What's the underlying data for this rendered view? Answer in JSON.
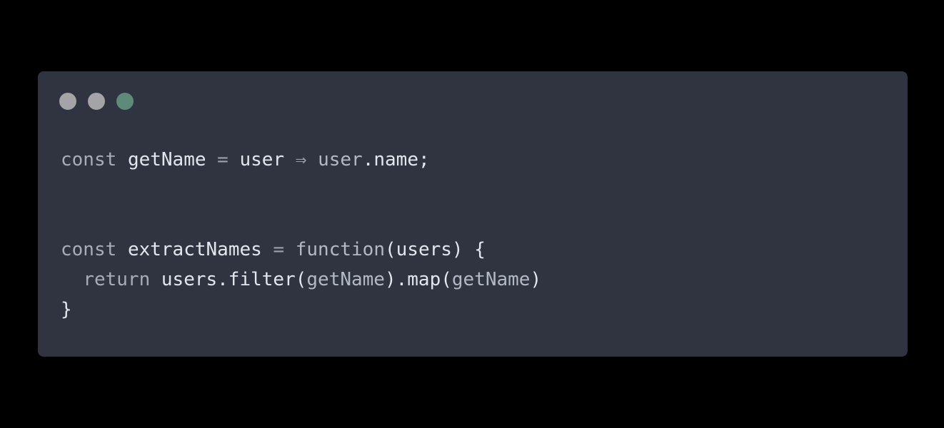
{
  "window": {
    "background": "#303441",
    "dots": [
      {
        "name": "close-dot",
        "color": "#a4a4a6"
      },
      {
        "name": "minimize-dot",
        "color": "#a4a4a6"
      },
      {
        "name": "maximize-dot",
        "color": "#5e8a7c"
      }
    ]
  },
  "code": {
    "lines": [
      [
        {
          "text": "const",
          "kind": "kw"
        },
        {
          "text": " ",
          "kind": "punct"
        },
        {
          "text": "getName",
          "kind": "id"
        },
        {
          "text": " ",
          "kind": "punct"
        },
        {
          "text": "=",
          "kind": "op"
        },
        {
          "text": " ",
          "kind": "punct"
        },
        {
          "text": "user",
          "kind": "id"
        },
        {
          "text": " ",
          "kind": "punct"
        },
        {
          "text": "⇒",
          "kind": "op"
        },
        {
          "text": " ",
          "kind": "punct"
        },
        {
          "text": "user",
          "kind": "dim"
        },
        {
          "text": ".name;",
          "kind": "id"
        }
      ],
      [],
      [],
      [
        {
          "text": "const",
          "kind": "kw"
        },
        {
          "text": " ",
          "kind": "punct"
        },
        {
          "text": "extractNames",
          "kind": "id"
        },
        {
          "text": " ",
          "kind": "punct"
        },
        {
          "text": "=",
          "kind": "op"
        },
        {
          "text": " ",
          "kind": "punct"
        },
        {
          "text": "function",
          "kind": "dim"
        },
        {
          "text": "(users) {",
          "kind": "id"
        }
      ],
      [
        {
          "text": "  ",
          "kind": "punct"
        },
        {
          "text": "return",
          "kind": "kw"
        },
        {
          "text": " ",
          "kind": "punct"
        },
        {
          "text": "users.filter(",
          "kind": "id"
        },
        {
          "text": "getName",
          "kind": "dim"
        },
        {
          "text": ").map(",
          "kind": "id"
        },
        {
          "text": "getName",
          "kind": "dim"
        },
        {
          "text": ")",
          "kind": "id"
        }
      ],
      [
        {
          "text": "}",
          "kind": "id"
        }
      ]
    ]
  }
}
